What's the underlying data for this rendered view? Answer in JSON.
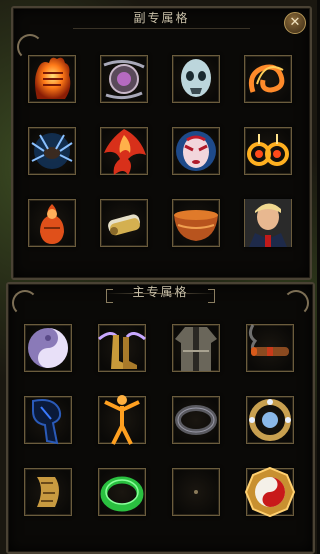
{
  "top_panel": {
    "title": "副专属格",
    "close_label": "✕",
    "slots": [
      {
        "name": "fire-fist"
      },
      {
        "name": "chain-amulet"
      },
      {
        "name": "ghost-mask"
      },
      {
        "name": "flame-swirl"
      },
      {
        "name": "ice-spider"
      },
      {
        "name": "fire-phoenix"
      },
      {
        "name": "opera-mask"
      },
      {
        "name": "fire-earrings"
      },
      {
        "name": "flame-figure"
      },
      {
        "name": "scroll-bundle"
      },
      {
        "name": "bronze-bowl"
      },
      {
        "name": "portrait-card"
      }
    ]
  },
  "bottom_panel": {
    "title": "主专属格",
    "slots": [
      {
        "name": "yinyang-orb"
      },
      {
        "name": "winged-boots"
      },
      {
        "name": "dark-robe"
      },
      {
        "name": "cigar"
      },
      {
        "name": "dark-rune"
      },
      {
        "name": "golden-figure"
      },
      {
        "name": "black-bracelet"
      },
      {
        "name": "jeweled-ring"
      },
      {
        "name": "gold-bracer"
      },
      {
        "name": "jade-ring"
      },
      {
        "name": "empty-slot"
      },
      {
        "name": "taiji-bagua"
      }
    ]
  }
}
